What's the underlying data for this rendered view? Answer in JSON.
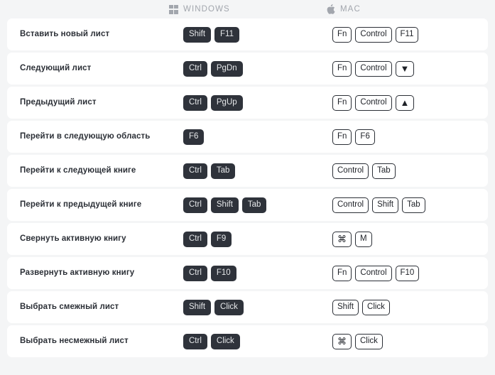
{
  "header": {
    "label_column": "",
    "windows": {
      "icon": "windows-logo-icon",
      "label": "WINDOWS"
    },
    "mac": {
      "icon": "apple-logo-icon",
      "label": "MAC"
    }
  },
  "colors": {
    "page_background": "#f4f5f6",
    "row_background": "#ffffff",
    "dark_key_background": "#2f333b",
    "dark_key_text": "#e6e8ea",
    "light_key_border": "#2b2f36",
    "label_text": "#2b2f36",
    "header_text": "#a2a6ad"
  },
  "rows": [
    {
      "label": "Вставить новый лист",
      "windows": [
        "Shift",
        "F11"
      ],
      "mac": [
        "Fn",
        "Control",
        "F11"
      ]
    },
    {
      "label": "Следующий лист",
      "windows": [
        "Ctrl",
        "PgDn"
      ],
      "mac": [
        "Fn",
        "Control",
        "▼"
      ]
    },
    {
      "label": "Предыдущий лист",
      "windows": [
        "Ctrl",
        "PgUp"
      ],
      "mac": [
        "Fn",
        "Control",
        "▲"
      ]
    },
    {
      "label": "Перейти в следующую область",
      "windows": [
        "F6"
      ],
      "mac": [
        "Fn",
        "F6"
      ]
    },
    {
      "label": "Перейти к следующей книге",
      "windows": [
        "Ctrl",
        "Tab"
      ],
      "mac": [
        "Control",
        "Tab"
      ]
    },
    {
      "label": "Перейти к предыдущей книге",
      "windows": [
        "Ctrl",
        "Shift",
        "Tab"
      ],
      "mac": [
        "Control",
        "Shift",
        "Tab"
      ]
    },
    {
      "label": "Свернуть активную книгу",
      "windows": [
        "Ctrl",
        "F9"
      ],
      "mac": [
        "⌘",
        "M"
      ]
    },
    {
      "label": "Развернуть активную книгу",
      "windows": [
        "Ctrl",
        "F10"
      ],
      "mac": [
        "Fn",
        "Control",
        "F10"
      ]
    },
    {
      "label": "Выбрать смежный лист",
      "windows": [
        "Shift",
        "Click"
      ],
      "mac": [
        "Shift",
        "Click"
      ]
    },
    {
      "label": "Выбрать несмежный лист",
      "windows": [
        "Ctrl",
        "Click"
      ],
      "mac": [
        "⌘",
        "Click"
      ]
    }
  ]
}
